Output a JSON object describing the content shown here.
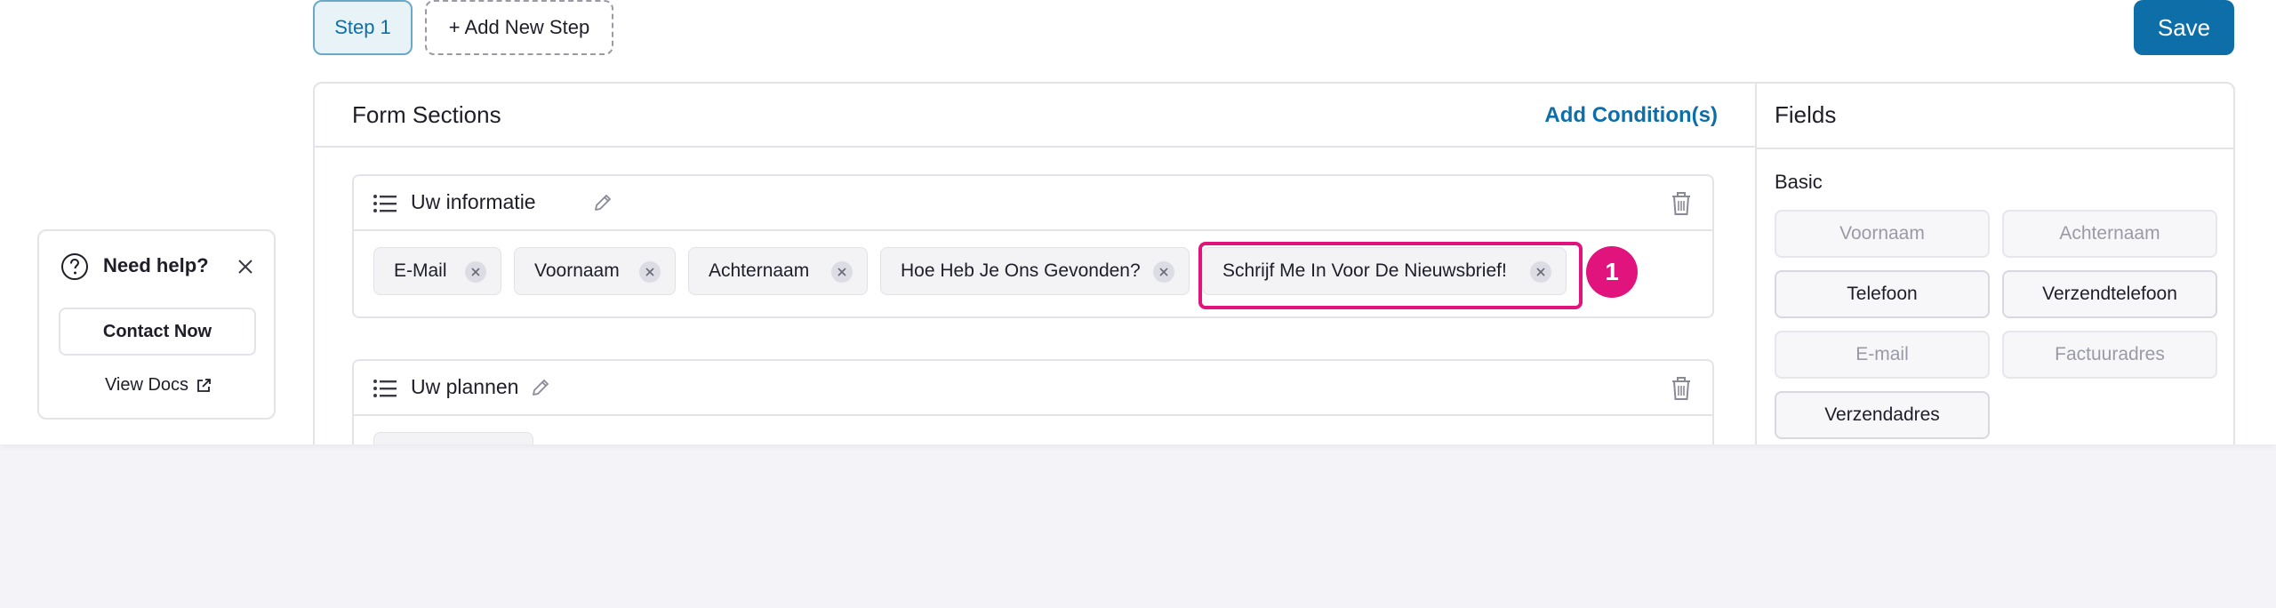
{
  "steps": {
    "tabs": [
      {
        "label": "Step 1"
      }
    ],
    "add_new_step_label": "+ Add New Step"
  },
  "toolbar": {
    "save_label": "Save"
  },
  "form_sections": {
    "title": "Form Sections",
    "add_condition_label": "Add Condition(s)",
    "sections": [
      {
        "title": "Uw informatie",
        "fields": [
          "E-Mail",
          "Voornaam",
          "Achternaam",
          "Hoe Heb Je Ons Gevonden?",
          "Schrijf Me In Voor De Nieuwsbrief!"
        ]
      },
      {
        "title": "Uw plannen",
        "fields": []
      }
    ]
  },
  "annotation": {
    "marker": "1",
    "color": "#e0147c"
  },
  "fields_panel": {
    "title": "Fields",
    "group_label": "Basic",
    "fields": [
      {
        "label": "Voornaam",
        "state": "disabled"
      },
      {
        "label": "Achternaam",
        "state": "disabled"
      },
      {
        "label": "Telefoon",
        "state": "enabled"
      },
      {
        "label": "Verzendtelefoon",
        "state": "enabled"
      },
      {
        "label": "E-mail",
        "state": "disabled"
      },
      {
        "label": "Factuuradres",
        "state": "disabled"
      },
      {
        "label": "Verzendadres",
        "state": "enabled"
      }
    ]
  },
  "help": {
    "title": "Need help?",
    "contact_label": "Contact Now",
    "docs_label": "View Docs"
  },
  "colors": {
    "accent": "#0e6ea8",
    "highlight": "#e0147c"
  }
}
